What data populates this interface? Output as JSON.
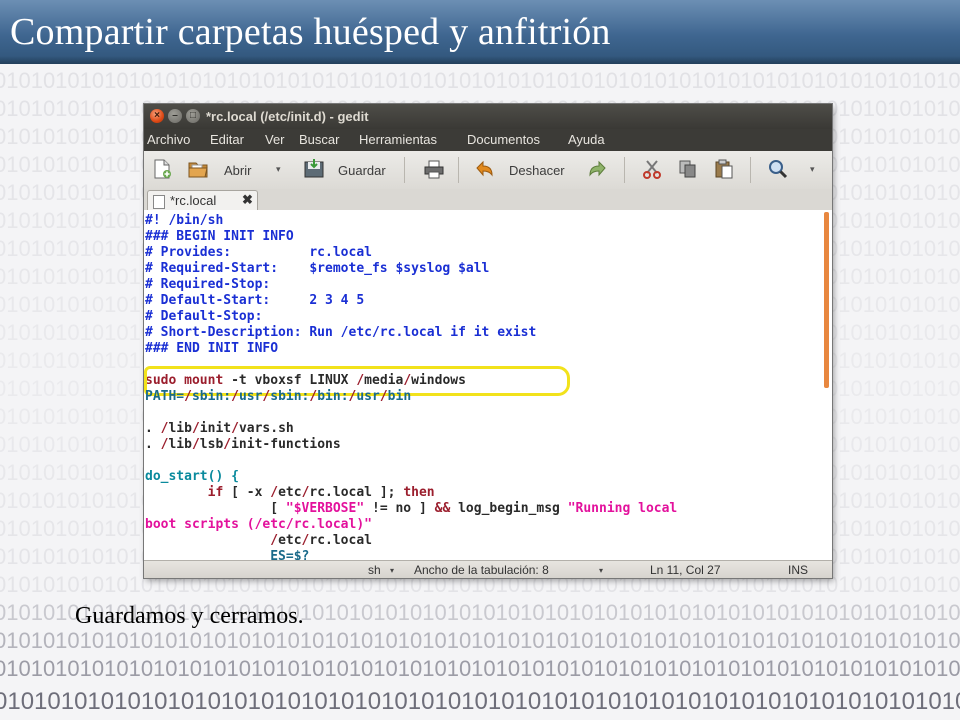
{
  "slide": {
    "title": "Compartir carpetas huésped y anfitrión",
    "caption": "Guardamos y cerramos.",
    "binary_row": "01010101010101010101010101010101010101010101010101010101010101010101010101010101010101010101010101"
  },
  "window": {
    "title": "*rc.local (/etc/init.d) - gedit",
    "controls": {
      "close": "×",
      "minimize": "–",
      "maximize": "□"
    }
  },
  "menu": [
    "Archivo",
    "Editar",
    "Ver",
    "Buscar",
    "Herramientas",
    "Documentos",
    "Ayuda"
  ],
  "toolbar": {
    "open_label": "Abrir",
    "save_label": "Guardar",
    "undo_label": "Deshacer",
    "dropdown_arrow": "▾"
  },
  "tab": {
    "label": "*rc.local",
    "close": "✖"
  },
  "code": {
    "l1": {
      "a": "#! /bin/sh"
    },
    "l2": {
      "a": "### BEGIN INIT INFO"
    },
    "l3": {
      "a": "# Provides:          rc.local"
    },
    "l4": {
      "a": "# Required-Start:    $remote_fs $syslog $all"
    },
    "l5": {
      "a": "# Required-Stop:"
    },
    "l6": {
      "a": "# Default-Start:     2 3 4 5"
    },
    "l7": {
      "a": "# Default-Stop:"
    },
    "l8": {
      "a": "# Short-Description: Run /etc/rc.local if it exist"
    },
    "l9": {
      "a": "### END INIT INFO"
    },
    "l10": {
      "a": "sudo mount",
      "b": " -t vboxsf LINUX ",
      "c": "/",
      "d": "media",
      "e": "/",
      "f": "windows"
    },
    "l11": {
      "a": "PATH=",
      "b": "/",
      "c": "sbin:",
      "d": "/",
      "e": "usr",
      "f": "/",
      "g": "sbin:",
      "h": "/",
      "i": "bin:",
      "j": "/",
      "k": "usr",
      "l": "/",
      "m": "bin"
    },
    "l12": {
      "a": ". ",
      "b": "/",
      "c": "lib",
      "d": "/",
      "e": "init",
      "f": "/",
      "g": "vars.sh"
    },
    "l13": {
      "a": ". ",
      "b": "/",
      "c": "lib",
      "d": "/",
      "e": "lsb",
      "f": "/",
      "g": "init-functions"
    },
    "l14": {
      "a": "do_start() {"
    },
    "l15": {
      "a": "        ",
      "b": "if",
      "c": " [ -x ",
      "d": "/",
      "e": "etc",
      "f": "/",
      "g": "rc.local ]; ",
      "h": "then"
    },
    "l16": {
      "a": "                [ ",
      "b": "\"$VERBOSE\"",
      "c": " != no ] ",
      "d": "&&",
      "e": " log_begin_msg ",
      "f": "\"Running local"
    },
    "l17": {
      "a": "boot scripts (/etc/rc.local)\""
    },
    "l18": {
      "a": "                ",
      "b": "/",
      "c": "etc",
      "d": "/",
      "e": "rc.local"
    },
    "l19": {
      "a": "                ES=$?"
    }
  },
  "status": {
    "language": "sh",
    "tab_width": "Ancho de la tabulación: 8",
    "position": "Ln 11, Col 27",
    "mode": "INS",
    "arrow": "▾"
  },
  "colors": {
    "comment": "#1a2fd4",
    "keyword": "#9b1e2d",
    "string": "#e3119c",
    "function": "#0a8a9d",
    "highlight": "#f2e21b",
    "header": "#3f6690"
  }
}
